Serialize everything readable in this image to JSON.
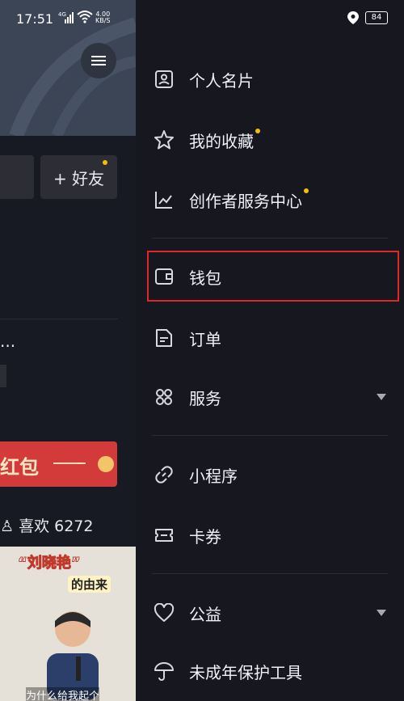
{
  "status": {
    "time": "17:51",
    "network": "4G",
    "speed_value": "4.00",
    "speed_unit": "KB/S",
    "battery": "84"
  },
  "profile_bg": {
    "add_friend": "+ 好友"
  },
  "feed": {
    "ellipsis": "...",
    "banner_text": "红包",
    "likes": "喜欢 6272",
    "video": {
      "title": "“刘晓艳”",
      "subtitle": "的由来",
      "caption": "为什么给我起个"
    }
  },
  "drawer": {
    "items": [
      {
        "label": "个人名片",
        "icon": "id-card-icon"
      },
      {
        "label": "我的收藏",
        "icon": "star-icon",
        "badge": true
      },
      {
        "label": "创作者服务中心",
        "icon": "chart-icon",
        "badge": true
      },
      {
        "label": "钱包",
        "icon": "wallet-icon",
        "highlighted": true
      },
      {
        "label": "订单",
        "icon": "document-icon"
      },
      {
        "label": "服务",
        "icon": "grid-icon",
        "expandable": true
      },
      {
        "label": "小程序",
        "icon": "link-icon"
      },
      {
        "label": "卡券",
        "icon": "ticket-icon"
      },
      {
        "label": "公益",
        "icon": "heart-icon",
        "expandable": true
      },
      {
        "label": "未成年保护工具",
        "icon": "umbrella-icon"
      }
    ]
  },
  "colors": {
    "accent_badge": "#f5c000",
    "highlight_border": "#e02626",
    "drawer_bg": "#16171f"
  }
}
